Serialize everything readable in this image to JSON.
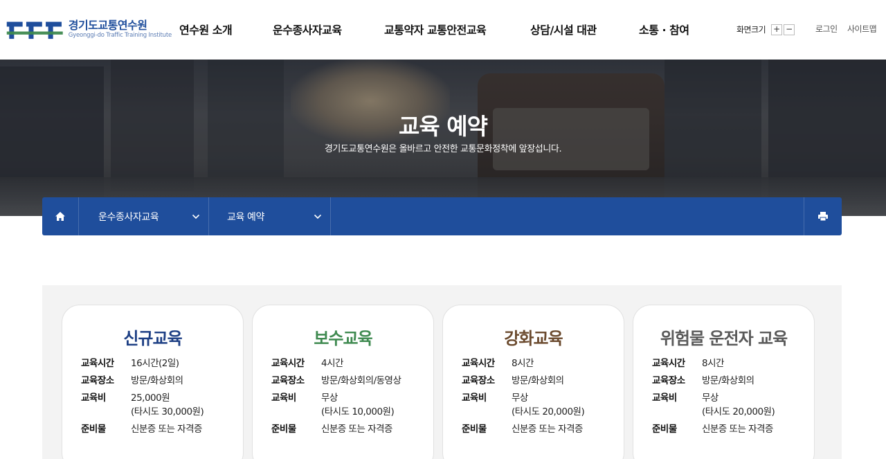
{
  "header": {
    "logo": {
      "name": "경기도교통연수원",
      "sub": "Gyeonggi-do Traffic Training Institute"
    },
    "gnb": [
      "연수원 소개",
      "운수종사자교육",
      "교통약자 교통안전교육",
      "상담/시설 대관",
      "소통 · 참여"
    ],
    "fontsize_label": "화면크기",
    "fontsize_plus": "+",
    "fontsize_minus": "−",
    "login": "로그인",
    "sitemap": "사이트맵"
  },
  "hero": {
    "title": "교육 예약",
    "subtitle": "경기도교통연수원은 올바르고 안전한 교통문화정착에 앞장섭니다."
  },
  "location": {
    "depth1": "운수종사자교육",
    "depth2": "교육 예약"
  },
  "colors": {
    "brand": "#1f4e9c",
    "card1_title": "#1d3f84",
    "card2_title": "#3f8a50",
    "card3_title": "#6b4a2e",
    "card4_title": "#595959"
  },
  "cards": [
    {
      "title": "신규교육",
      "rows": [
        {
          "k": "교육시간",
          "v": "16시간(2일)"
        },
        {
          "k": "교육장소",
          "v": "방문/화상회의"
        },
        {
          "k": "교육비",
          "v": "25,000원",
          "v2": "(타시도 30,000원)"
        },
        {
          "k": "준비물",
          "v": "신분증 또는 자격증"
        }
      ]
    },
    {
      "title": "보수교육",
      "rows": [
        {
          "k": "교육시간",
          "v": "4시간"
        },
        {
          "k": "교육장소",
          "v": "방문/화상회의/동영상"
        },
        {
          "k": "교육비",
          "v": "무상",
          "v2": "(타시도 10,000원)"
        },
        {
          "k": "준비물",
          "v": "신분증 또는 자격증"
        }
      ]
    },
    {
      "title": "강화교육",
      "rows": [
        {
          "k": "교육시간",
          "v": "8시간"
        },
        {
          "k": "교육장소",
          "v": "방문/화상회의"
        },
        {
          "k": "교육비",
          "v": "무상",
          "v2": "(타시도 20,000원)"
        },
        {
          "k": "준비물",
          "v": "신분증 또는 자격증"
        }
      ]
    },
    {
      "title": "위험물 운전자 교육",
      "rows": [
        {
          "k": "교육시간",
          "v": "8시간"
        },
        {
          "k": "교육장소",
          "v": "방문/화상회의"
        },
        {
          "k": "교육비",
          "v": "무상",
          "v2": "(타시도 20,000원)"
        },
        {
          "k": "준비물",
          "v": "신분증 또는 자격증"
        }
      ]
    }
  ]
}
